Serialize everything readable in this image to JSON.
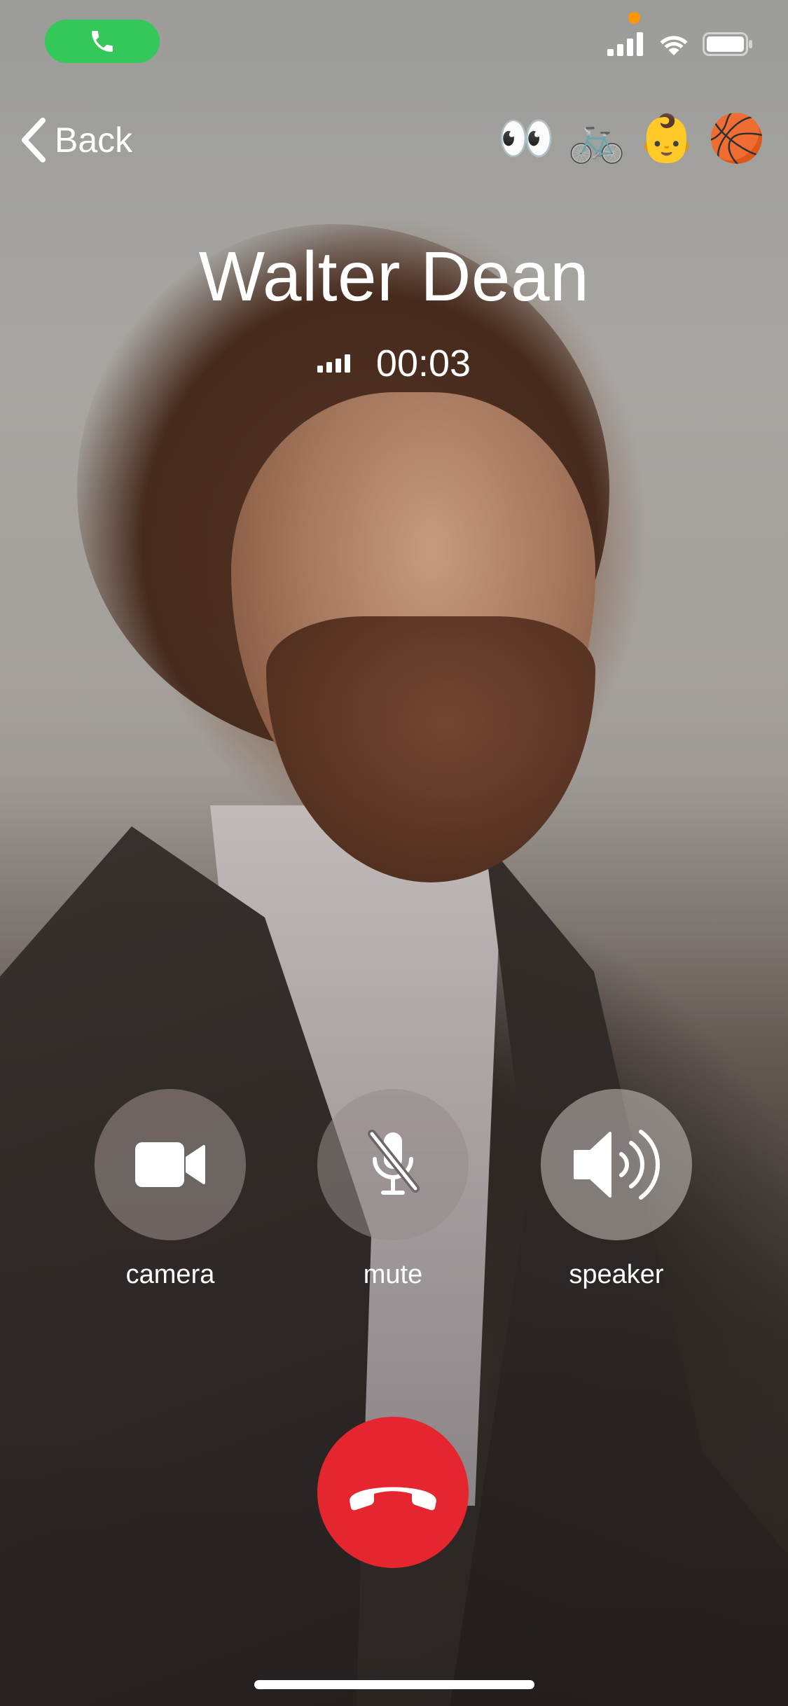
{
  "status_bar": {
    "call_pill_icon": "phone-icon",
    "call_pill_color": "#34c759",
    "privacy_indicator_color": "#ff9500",
    "icons": [
      "cellular-signal-icon",
      "wifi-icon",
      "battery-icon"
    ]
  },
  "nav": {
    "back_label": "Back",
    "emoji_key": [
      "👀",
      "🚲",
      "👶",
      "🏀"
    ]
  },
  "caller": {
    "name": "Walter Dean",
    "timer": "00:03",
    "signal_icon": "signal-strength-icon"
  },
  "controls": [
    {
      "label": "camera",
      "icon": "video-camera-icon"
    },
    {
      "label": "mute",
      "icon": "microphone-slash-icon"
    },
    {
      "label": "speaker",
      "icon": "speaker-volume-icon"
    }
  ],
  "end_call": {
    "icon": "end-call-icon",
    "color": "#e5262f"
  }
}
